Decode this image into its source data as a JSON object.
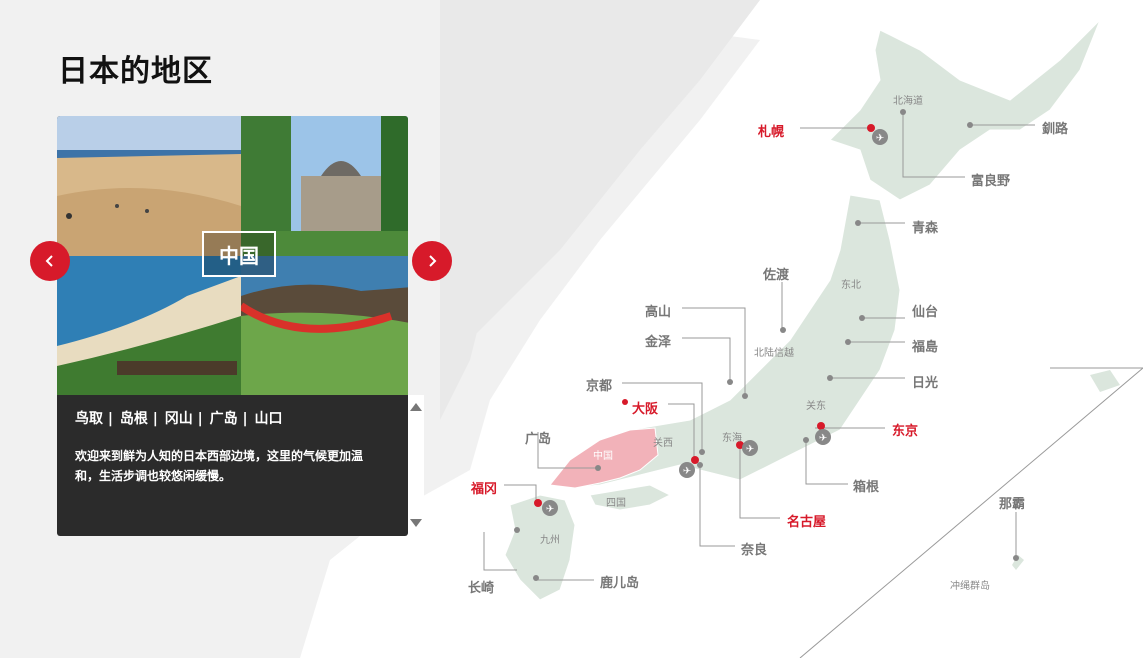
{
  "page": {
    "title": "日本的地区"
  },
  "carousel": {
    "region_badge": "中国",
    "prefectures": [
      "鸟取 | ",
      "岛根 | ",
      "冈山 | ",
      "广岛 | ",
      "山口"
    ],
    "description": "欢迎来到鲜为人知的日本西部边境，这里的气候更加温和，生活步调也较悠闲缓慢。",
    "prev_icon": "chevron-left-icon",
    "next_icon": "chevron-right-icon"
  },
  "map": {
    "cities": {
      "sapporo": "札幌",
      "kushiro": "釧路",
      "furano": "富良野",
      "aomori": "青森",
      "sado": "佐渡",
      "sendai": "仙台",
      "fukushima": "福島",
      "nikko": "日光",
      "takayama": "高山",
      "kanazawa": "金泽",
      "kyoto": "京都",
      "osaka": "大阪",
      "tokyo": "东京",
      "hiroshima": "广岛",
      "hakone": "箱根",
      "fukuoka": "福冈",
      "nagoya": "名古屋",
      "nara": "奈良",
      "naha": "那霸",
      "nagasaki": "长崎",
      "kagoshima": "鹿儿岛"
    },
    "regions": {
      "hokkaido": "北海道",
      "tohoku": "东北",
      "hokuriku": "北陆信越",
      "kanto": "关东",
      "tokai": "东海",
      "kansai": "关西",
      "chugoku": "中国",
      "shikoku": "四国",
      "kyushu": "九州",
      "okinawa": "冲绳群岛"
    },
    "highlight_color": "#d71a2a",
    "land_color": "#dbe6dd"
  }
}
